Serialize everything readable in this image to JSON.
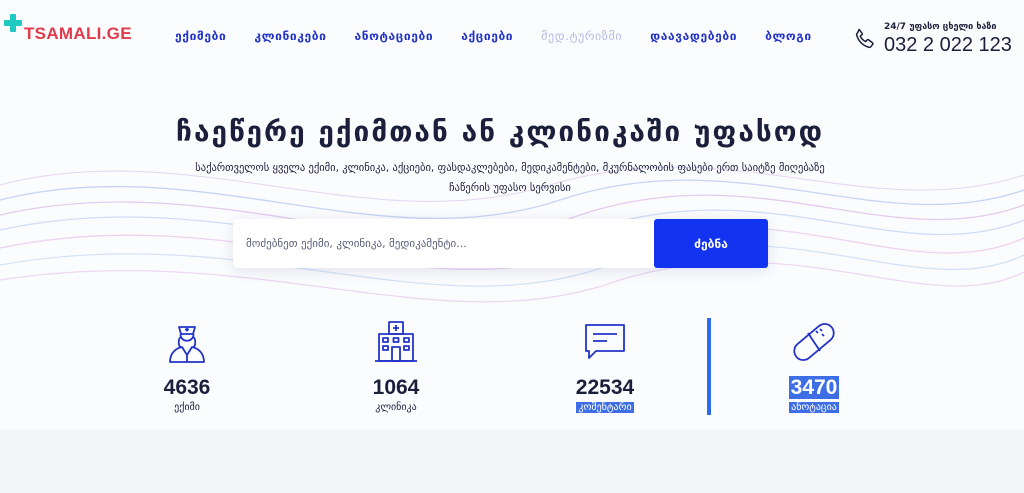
{
  "brand": {
    "logo_text": "TSAMALI.GE"
  },
  "nav": {
    "items": [
      {
        "label": "ექიმები"
      },
      {
        "label": "კლინიკები"
      },
      {
        "label": "ანოტაციები"
      },
      {
        "label": "აქციები"
      },
      {
        "label": "მედ.ტურიზმი"
      },
      {
        "label": "დაავადებები"
      },
      {
        "label": "ბლოგი"
      }
    ]
  },
  "hotline": {
    "caption": "24/7 უფასო ცხელი ხაზი",
    "number": "032 2 022 123"
  },
  "hero": {
    "title": "ჩაეწერე ექიმთან ან კლინიკაში უფასოდ",
    "subtitle": "საქართველოს ყველა ექიმი, კლინიკა, აქციები, ფასდაკლებები, მედიკამენტები, მკურნალობის ფასები ერთ საიტზე მიღებაზე ჩაწერის უფასო სერვისი"
  },
  "search": {
    "placeholder": "მოძებნეთ ექიმი, კლინიკა, მედიკამენტი...",
    "button_label": "ძებნა"
  },
  "stats": [
    {
      "value": "4636",
      "label": "ექიმი",
      "icon": "doctor-icon",
      "highlighted": false
    },
    {
      "value": "1064",
      "label": "კლინიკა",
      "icon": "hospital-icon",
      "highlighted": false
    },
    {
      "value": "22534",
      "label": "კომენტარი",
      "icon": "comment-icon",
      "highlighted": "label"
    },
    {
      "value": "3470",
      "label": "ანოტაცია",
      "icon": "pill-icon",
      "highlighted": "both"
    }
  ],
  "colors": {
    "primary": "#1233f0",
    "nav_text": "#2333c7",
    "brand_red": "#e23a4b",
    "brand_teal": "#20c9c2",
    "divider": "#2c6cf0"
  }
}
